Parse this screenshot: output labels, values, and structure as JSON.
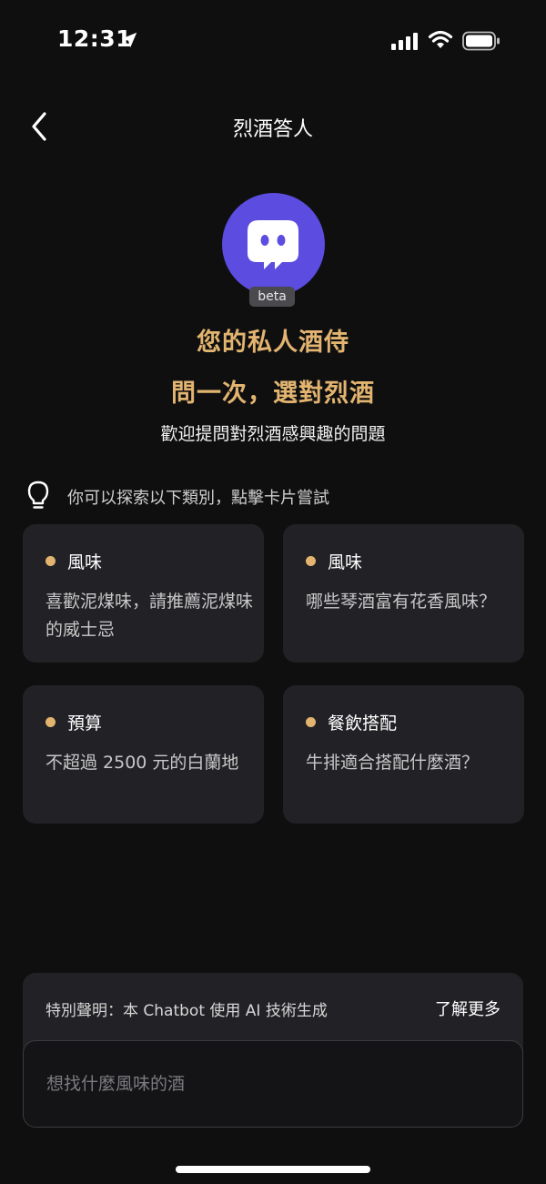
{
  "status_bar": {
    "time": "12:31",
    "icons": [
      "location-arrow-icon",
      "cellular-signal-icon",
      "wifi-icon",
      "battery-icon"
    ]
  },
  "nav": {
    "title": "烈酒答人",
    "back_icon": "chevron-left-icon"
  },
  "hero": {
    "avatar_icon": "chatbot-icon",
    "badge": "beta",
    "headline_1": "您的私人酒侍",
    "headline_2": "問一次，選對烈酒",
    "subtitle": "歡迎提問對烈酒感興趣的問題"
  },
  "hint": {
    "icon": "lightbulb-icon",
    "text": "你可以探索以下類別，點擊卡片嘗試"
  },
  "cards": [
    {
      "tag": "風味",
      "text": "喜歡泥煤味，請推薦泥煤味的威士忌"
    },
    {
      "tag": "風味",
      "text": "哪些琴酒富有花香風味？"
    },
    {
      "tag": "預算",
      "text": "不超過 2500 元的白蘭地"
    },
    {
      "tag": "餐飲搭配",
      "text": "牛排適合搭配什麼酒？"
    }
  ],
  "disclaimer": {
    "text": "特別聲明：本 Chatbot 使用 AI 技術生成",
    "link": "了解更多"
  },
  "input": {
    "placeholder": "想找什麼風味的酒",
    "value": ""
  },
  "colors": {
    "background": "#0f0f10",
    "card": "#222226",
    "accent_gold": "#e2b470",
    "avatar_purple": "#5c4ce0"
  }
}
